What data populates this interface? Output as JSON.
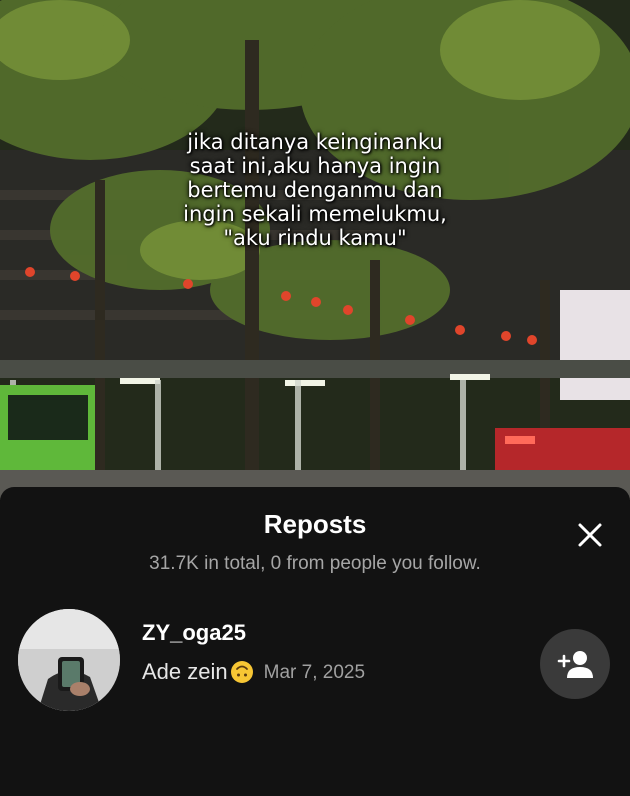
{
  "video": {
    "overlay_text": "jika ditanya keinginanku\nsaat ini,aku hanya ingin\nbertemu denganmu dan\ningin sekali memelukmu,\n\"aku rindu kamu\""
  },
  "reposts_sheet": {
    "title": "Reposts",
    "summary": "31.7K in total, 0 from people you follow.",
    "close_icon": "close-icon",
    "users": [
      {
        "username": "ZY_oga25",
        "display_name": "Ade zein",
        "emoji": "upside-down-face-emoji",
        "date": "Mar 7, 2025",
        "action_icon": "add-friend-icon"
      }
    ]
  },
  "colors": {
    "sheet_background": "#121212",
    "primary_text": "#ffffff",
    "secondary_text": "#a6a6a6",
    "follow_button_bg": "#3a3a3a"
  }
}
